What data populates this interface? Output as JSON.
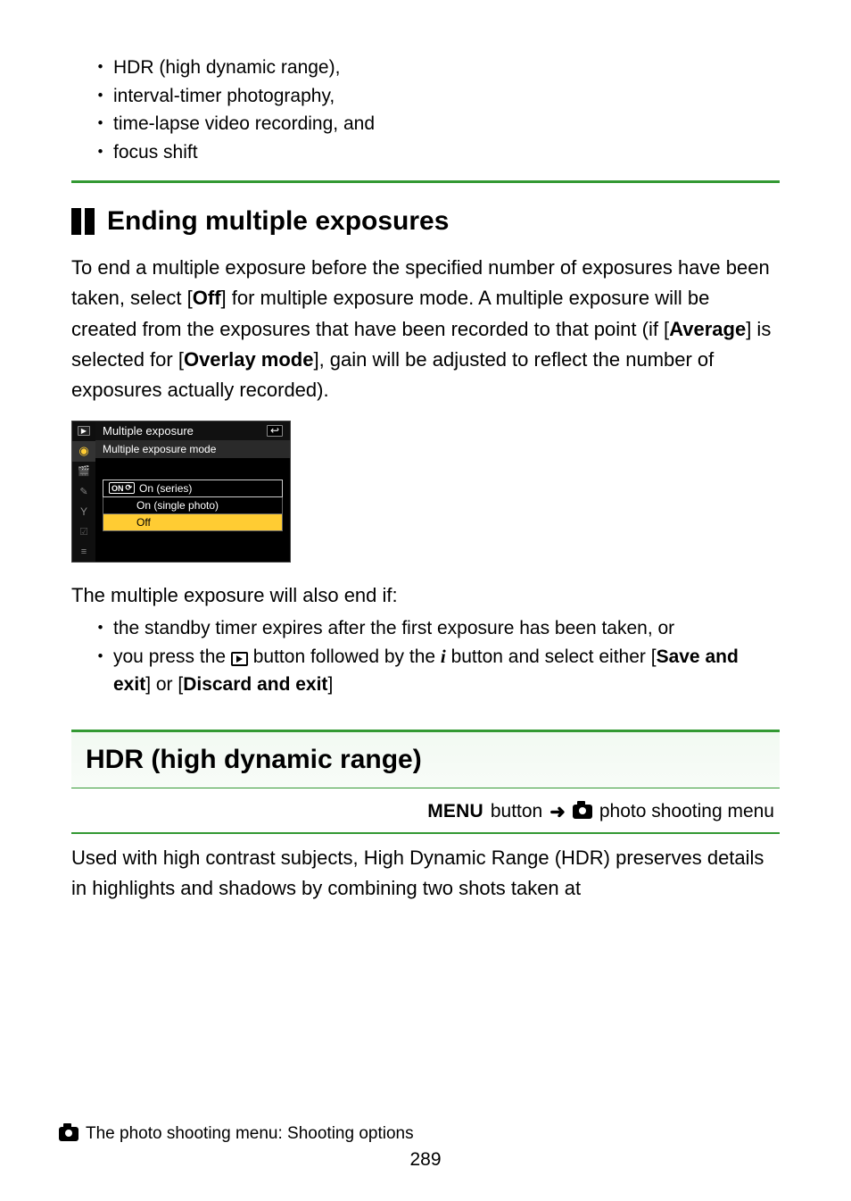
{
  "top_list": {
    "items": [
      "HDR (high dynamic range),",
      "interval-timer photography,",
      "time-lapse video recording, and",
      "focus shift"
    ]
  },
  "section1": {
    "heading": "Ending multiple exposures",
    "para_parts": {
      "p1": "To end a multiple exposure before the specified number of exposures have been taken, select [",
      "b1": "Off",
      "p2": "] for multiple exposure mode. A multiple exposure will be created from the exposures that have been recorded to that point (if [",
      "b2": "Average",
      "p3": "] is selected for [",
      "b3": "Overlay mode",
      "p4": "], gain will be adjusted to reflect the number of exposures actually recorded)."
    }
  },
  "menu_screenshot": {
    "header": "Multiple exposure",
    "subheader": "Multiple exposure mode",
    "option1_badge": "ON",
    "option1_label": "On (series)",
    "option2_label": "On (single photo)",
    "option3_label": "Off"
  },
  "end_list": {
    "intro": "The multiple exposure will also end if:",
    "item1": "the standby timer expires after the first exposure has been taken, or",
    "item2_parts": {
      "p1": "you press the ",
      "p2": " button followed by the ",
      "p3": " button and select either [",
      "b1": "Save and exit",
      "p4": "] or [",
      "b2": "Discard and exit",
      "p5": "]"
    }
  },
  "section2": {
    "heading": "HDR (high dynamic range)",
    "path_menu": "MENU",
    "path_button": " button ",
    "path_dest": " photo shooting menu",
    "body": "Used with high contrast subjects, High Dynamic Range (HDR) preserves details in highlights and shadows by combining two shots taken at"
  },
  "footer": {
    "text": "The photo shooting menu: Shooting options",
    "page": "289"
  }
}
